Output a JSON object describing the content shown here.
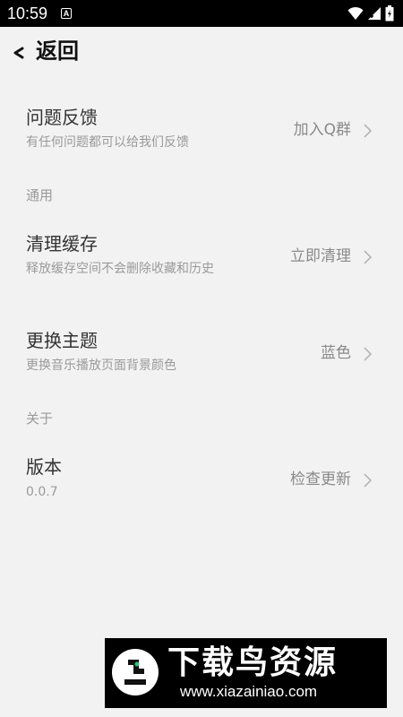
{
  "status_bar": {
    "time": "10:59",
    "notification_badge": "A",
    "icons": [
      "wifi-icon",
      "signal-icon",
      "battery-icon"
    ]
  },
  "nav": {
    "back_label": "返回"
  },
  "feedback_row": {
    "title": "问题反馈",
    "subtitle": "有任何问题都可以给我们反馈",
    "value": "加入Q群"
  },
  "section_general": {
    "label": "通用"
  },
  "clear_cache_row": {
    "title": "清理缓存",
    "subtitle": "释放缓存空间不会删除收藏和历史",
    "value": "立即清理"
  },
  "theme_row": {
    "title": "更换主题",
    "subtitle": "更换音乐播放页面背景颜色",
    "value": "蓝色"
  },
  "section_about": {
    "label": "关于"
  },
  "version_row": {
    "title": "版本",
    "subtitle": "0.0.7",
    "value": "检查更新"
  },
  "watermark": {
    "title": "下载鸟资源",
    "url": "www.xiazainiao.com"
  },
  "colors": {
    "background": "#f2f2f2",
    "status_bar": "#000000",
    "title_text": "#333333",
    "secondary_text": "#9a9a9a"
  }
}
